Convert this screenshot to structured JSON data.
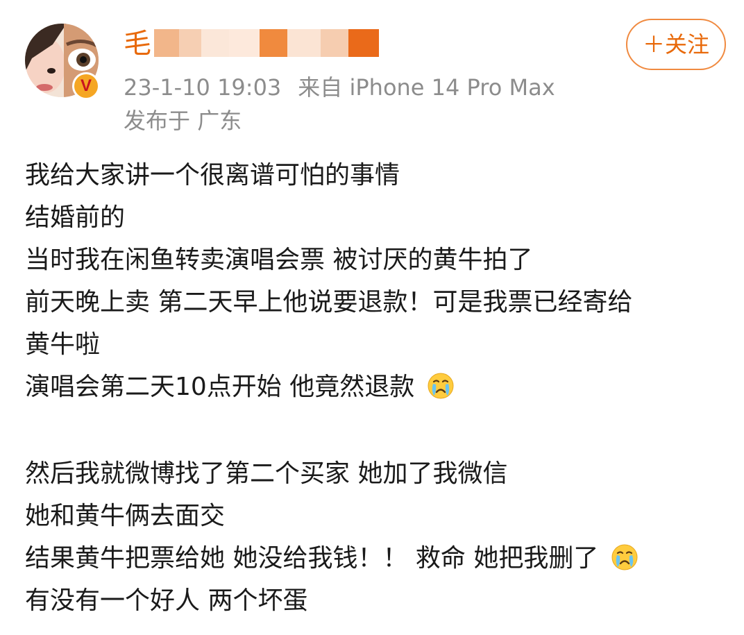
{
  "post": {
    "author": {
      "name_visible": "毛",
      "verified_badge": "V",
      "accent_color": "#e8690a"
    },
    "meta": {
      "timestamp": "23-1-10 19:03",
      "source_prefix": "来自",
      "source_device": "iPhone 14 Pro Max",
      "location_prefix": "发布于",
      "location": "广东"
    },
    "follow_button_label": "＋关注",
    "lines": [
      "我给大家讲一个很离谱可怕的事情",
      "结婚前的",
      "当时我在闲鱼转卖演唱会票 被讨厌的黄牛拍了",
      "前天晚上卖 第二天早上他说要退款！可是我票已经寄给",
      "黄牛啦",
      "演唱会第二天10点开始  他竟然退款",
      "然后我就微博找了第二个买家  她加了我微信",
      "她和黄牛俩去面交",
      "结果黄牛把票给她 她没给我钱！！  救命 她把我删了",
      "有没有一个好人 两个坏蛋"
    ],
    "emoji_icon": "crying-face-icon"
  }
}
